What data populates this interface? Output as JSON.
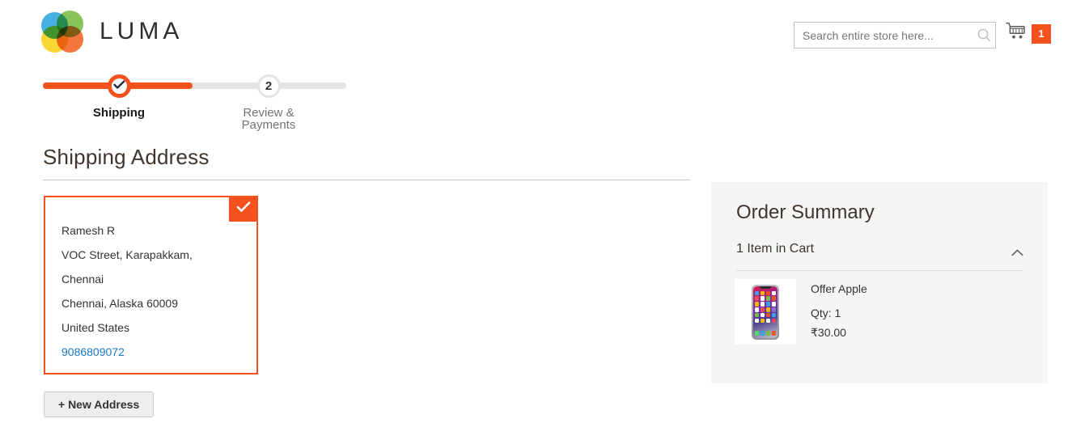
{
  "header": {
    "brand_name": "LUMA",
    "logo_colors": {
      "blue": "#2ba6dd",
      "green": "#76bc43",
      "orange": "#f26322",
      "yellow": "#f7d117"
    },
    "search": {
      "placeholder": "Search entire store here...",
      "value": ""
    },
    "cart": {
      "count": "1",
      "badge_color": "#f4511e"
    }
  },
  "checkout_progress": {
    "accent_color": "#f4511e",
    "steps": [
      {
        "label": "Shipping",
        "marker": "check",
        "state": "active"
      },
      {
        "label": "Review & Payments",
        "marker": "2",
        "state": "inactive"
      }
    ]
  },
  "shipping": {
    "title": "Shipping Address",
    "selected_address": {
      "selected": true,
      "lines": [
        {
          "text": "Ramesh R",
          "link": false
        },
        {
          "text": "VOC Street, Karapakkam,",
          "link": false
        },
        {
          "text": "Chennai",
          "link": false
        },
        {
          "text": "Chennai, Alaska 60009",
          "link": false
        },
        {
          "text": "United States",
          "link": false
        },
        {
          "text": "9086809072",
          "link": true
        }
      ]
    },
    "new_address_button": "+ New Address"
  },
  "order_summary": {
    "title": "Order Summary",
    "items_in_cart_label": "1 Item in Cart",
    "collapse_icon": "chevron-up-icon",
    "items": [
      {
        "name": "Offer Apple",
        "qty_label": "Qty: 1",
        "price": "₹30.00",
        "thumbnail": "iphone-x-product-image"
      }
    ]
  }
}
